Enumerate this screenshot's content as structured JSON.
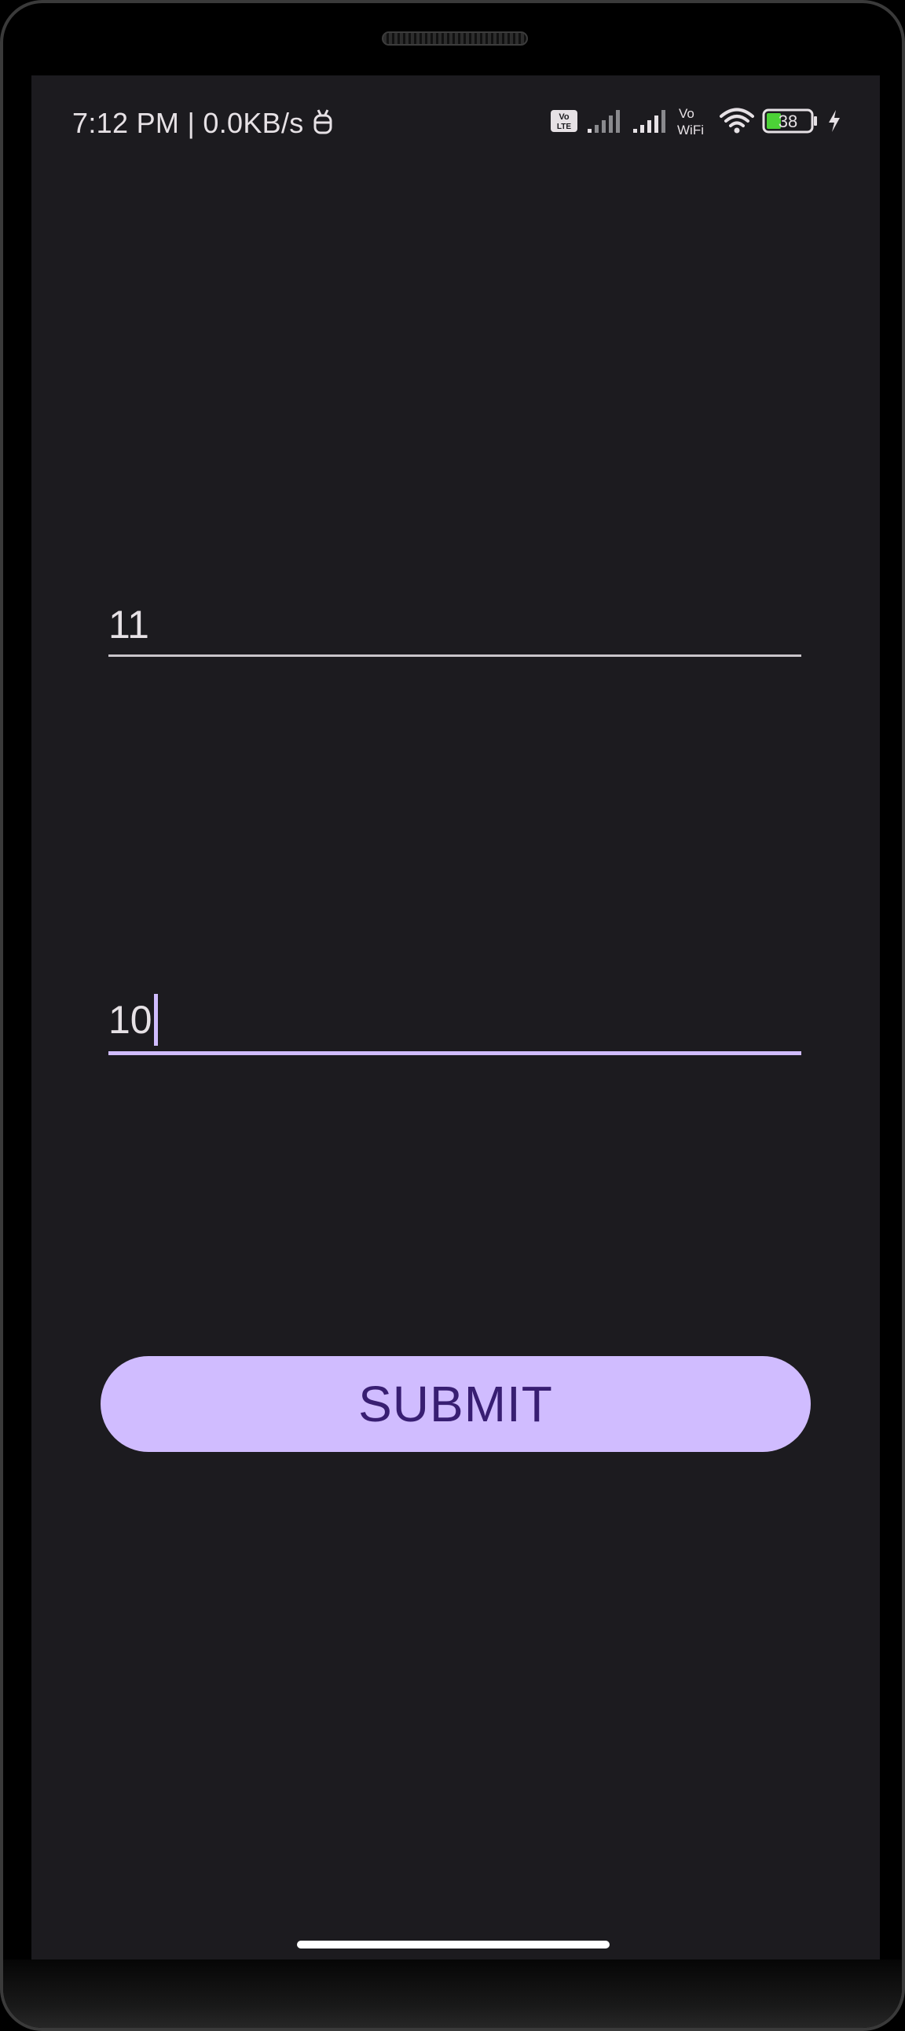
{
  "status_bar": {
    "time_speed": "7:12 PM | 0.0KB/s",
    "battery_level": "38",
    "icons": [
      "android-notification-icon",
      "volte-icon",
      "signal-sim1-icon",
      "signal-sim2-icon",
      "vowifi-icon",
      "wifi-icon",
      "battery-icon",
      "charging-bolt-icon"
    ]
  },
  "form": {
    "first_field_value": "11",
    "second_field_value": "10",
    "submit_label": "SUBMIT"
  },
  "colors": {
    "background": "#1c1b1f",
    "accent": "#d0bcff",
    "button_text": "#381e72",
    "text": "#e6e1e5"
  }
}
